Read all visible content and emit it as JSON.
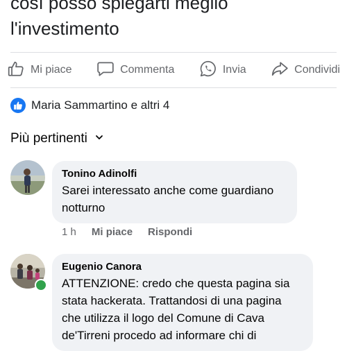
{
  "post": {
    "text_line1": "così posso spiegarti meglio",
    "text_line2": "l'investimento"
  },
  "actions": {
    "like": "Mi piace",
    "comment": "Commenta",
    "send": "Invia",
    "share": "Condividi"
  },
  "reactions": {
    "summary": "Maria Sammartino e altri 4"
  },
  "sort": {
    "label": "Più pertinenti"
  },
  "comments": [
    {
      "author": "Tonino Adinolfi",
      "text": "Sarei interessato anche come guardiano notturno",
      "time": "1 h",
      "like_label": "Mi piace",
      "reply_label": "Rispondi"
    },
    {
      "author": "Eugenio Canora",
      "text": "ATTENZIONE: credo che questa pagina sia stata hackerata. Trattandosi di una pagina che utilizza il logo del Comune di Cava de'Tirreni procedo ad informare chi di",
      "online": true
    }
  ],
  "colors": {
    "accent": "#1877f2",
    "bubble": "#f0f2f5",
    "secondary_text": "#65676b",
    "online": "#31a24c"
  }
}
